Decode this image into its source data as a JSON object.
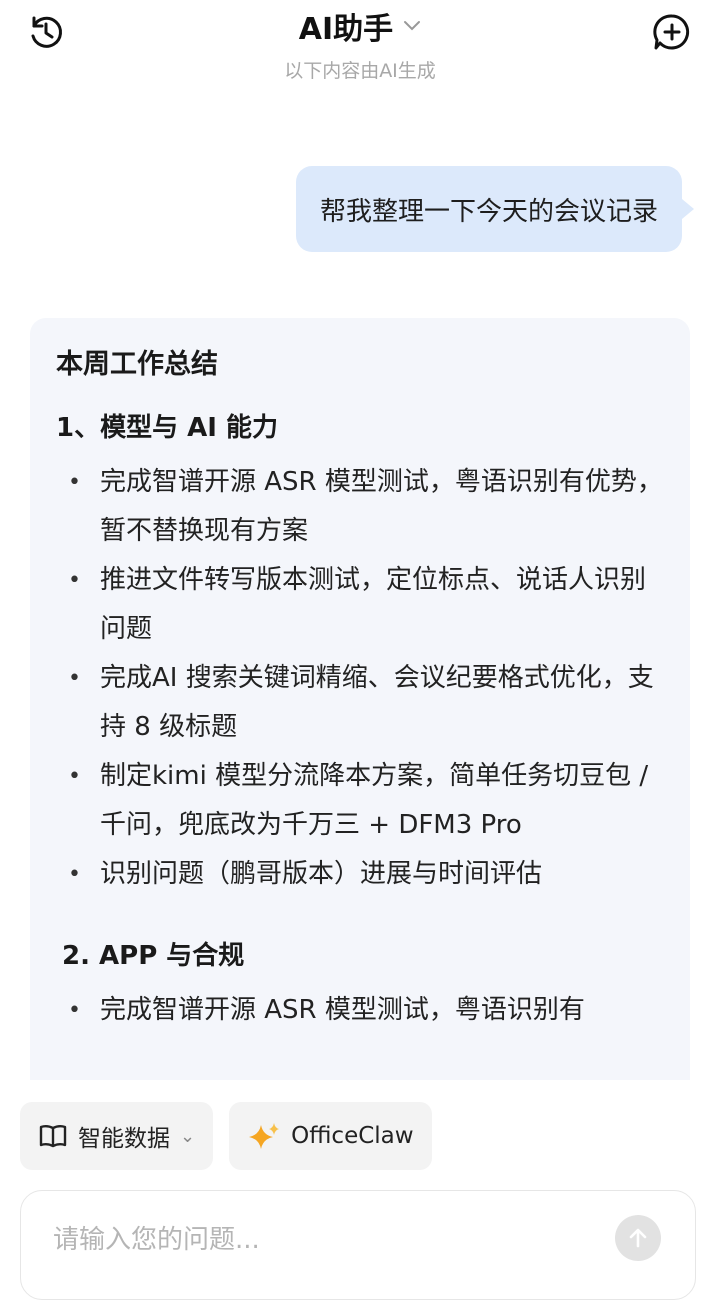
{
  "header": {
    "title": "AI助手",
    "subtitle": "以下内容由AI生成",
    "history_icon": "history-icon",
    "new_chat_icon": "new-chat-icon"
  },
  "user_message": "帮我整理一下今天的会议记录",
  "reply": {
    "heading": "本周工作总结",
    "sections": [
      {
        "title": "1、模型与 AI 能力",
        "items": [
          "完成智谱开源 ASR 模型测试，粤语识别有优势，暂不替换现有方案",
          "推进文件转写版本测试，定位标点、说话人识别问题",
          "完成AI 搜索关键词精缩、会议纪要格式优化，支持 8 级标题",
          "制定kimi 模型分流降本方案，简单任务切豆包 / 千问，兜底改为千万三 + DFM3 Pro",
          "识别问题（鹏哥版本）进展与时间评估"
        ]
      },
      {
        "title": "2. APP 与合规",
        "items": [
          "完成智谱开源 ASR 模型测试，粤语识别有"
        ]
      }
    ]
  },
  "chips": {
    "smart_data": "智能数据",
    "officeclaw": "OfficeClaw"
  },
  "input": {
    "placeholder": "请输入您的问题..."
  },
  "colors": {
    "user_bubble": "#dce9fb",
    "reply_bg": "#f4f6fb",
    "sparkle": "#f5a623"
  }
}
